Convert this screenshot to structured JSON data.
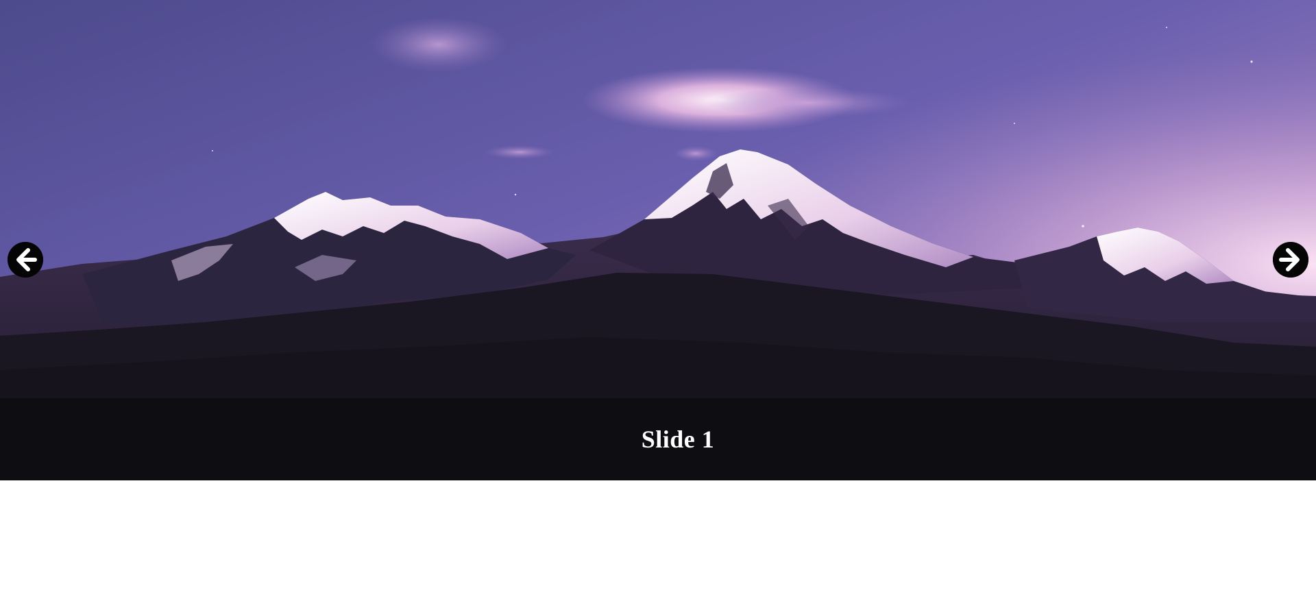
{
  "slider": {
    "current_slide": 1,
    "caption": "Slide 1",
    "prev_icon": "arrow-left-circle-icon",
    "next_icon": "arrow-right-circle-icon",
    "colors": {
      "sky_top": "#5b569c",
      "sky_glow": "#e9bfe0",
      "caption_bg": "#0e0d10",
      "caption_text": "#ffffff",
      "nav_bg": "#050505",
      "nav_arrow": "#ffffff"
    }
  }
}
